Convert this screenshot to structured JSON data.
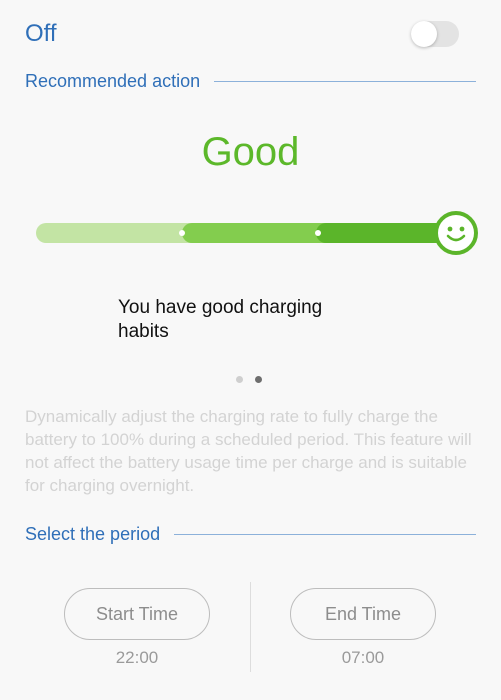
{
  "toggle": {
    "label": "Off",
    "state": "off"
  },
  "recommended": {
    "header": "Recommended action",
    "status": "Good",
    "level_fraction": 1.0,
    "message": "You have good charging habits",
    "pager": {
      "count": 2,
      "active_index": 1
    }
  },
  "description": "Dynamically adjust the charging rate to fully charge the battery to 100% during a scheduled period. This feature will not affect the battery usage time per charge and is suitable for charging overnight.",
  "period": {
    "header": "Select the period",
    "start": {
      "label": "Start Time",
      "value": "22:00"
    },
    "end": {
      "label": "End Time",
      "value": "07:00"
    }
  },
  "colors": {
    "accent_blue": "#2f6fb8",
    "good_green": "#5cb82a",
    "bar_light": "#c3e4a4",
    "bar_mid": "#83cd4e",
    "bar_dark": "#5bb52a"
  },
  "icons": {
    "status_face": "smiley-face-icon"
  }
}
